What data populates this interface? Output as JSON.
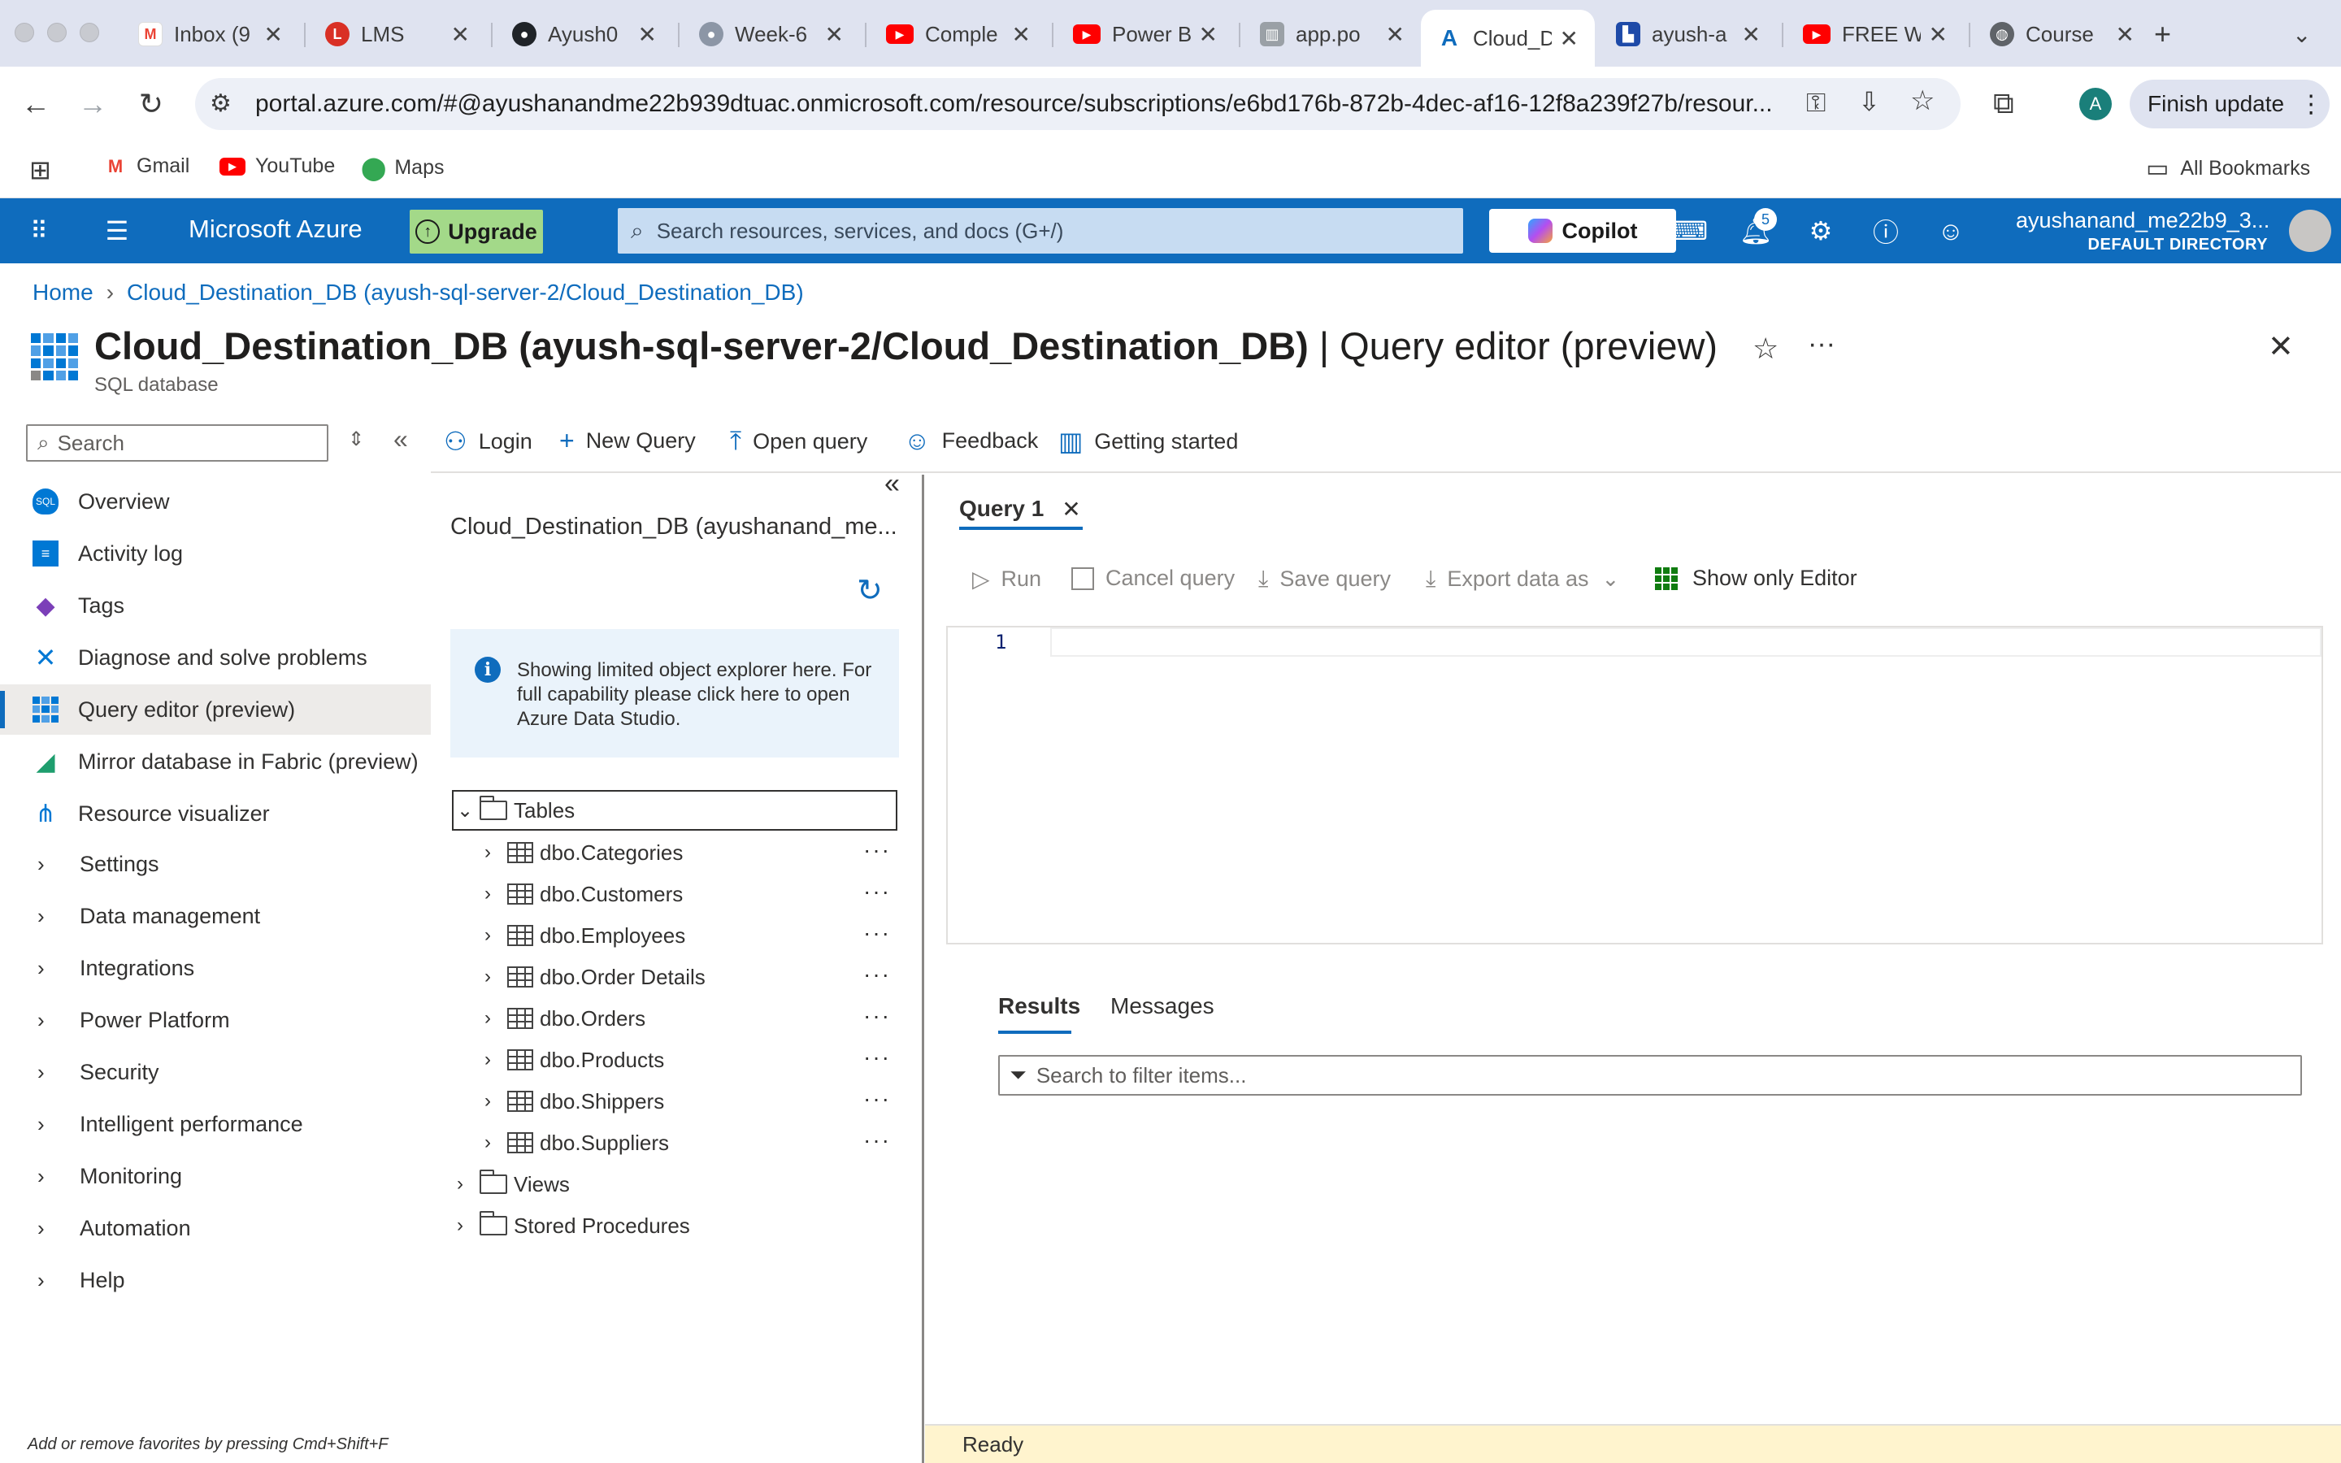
{
  "browser": {
    "tabs": [
      {
        "title": "Inbox (9",
        "icon": "gmail-icon",
        "color": "#ea4335"
      },
      {
        "title": "LMS",
        "icon": "lms-icon",
        "color": "#d93025"
      },
      {
        "title": "Ayush0",
        "icon": "github-icon",
        "color": "#1f2328"
      },
      {
        "title": "Week-6",
        "icon": "github-icon",
        "color": "#8c96a6"
      },
      {
        "title": "Comple",
        "icon": "youtube-icon",
        "color": "#ff0000"
      },
      {
        "title": "Power B",
        "icon": "youtube-icon",
        "color": "#ff0000"
      },
      {
        "title": "app.po",
        "icon": "building-icon",
        "color": "#777777"
      },
      {
        "title": "Cloud_D",
        "icon": "azure-icon",
        "color": "#0f6cbd"
      },
      {
        "title": "ayush-a",
        "icon": "factory-icon",
        "color": "#1e4aa8"
      },
      {
        "title": "FREE W",
        "icon": "youtube-icon",
        "color": "#ff0000"
      },
      {
        "title": "Course",
        "icon": "globe-icon",
        "color": "#5f6368"
      }
    ],
    "url": "portal.azure.com/#@ayushanandme22b939dtuac.onmicrosoft.com/resource/subscriptions/e6bd176b-872b-4dec-af16-12f8a239f27b/resour...",
    "finish_update": "Finish update",
    "profile_initial": "A",
    "bookmarks": [
      "Gmail",
      "YouTube",
      "Maps"
    ],
    "all_bookmarks": "All Bookmarks"
  },
  "azure": {
    "brand": "Microsoft Azure",
    "upgrade": "Upgrade",
    "search_placeholder": "Search resources, services, and docs (G+/)",
    "copilot": "Copilot",
    "notification_count": "5",
    "user_name": "ayushanand_me22b9_3...",
    "user_directory": "DEFAULT DIRECTORY"
  },
  "page": {
    "breadcrumb": [
      "Home",
      "Cloud_Destination_DB (ayush-sql-server-2/Cloud_Destination_DB)"
    ],
    "title": "Cloud_Destination_DB (ayush-sql-server-2/Cloud_Destination_DB)",
    "title_suffix": " | Query editor (preview)",
    "subtitle": "SQL database"
  },
  "menu": {
    "search_placeholder": "Search",
    "items": [
      {
        "label": "Overview",
        "icon": "sql-icon"
      },
      {
        "label": "Activity log",
        "icon": "activity-log-icon"
      },
      {
        "label": "Tags",
        "icon": "tag-icon"
      },
      {
        "label": "Diagnose and solve problems",
        "icon": "wrench-icon"
      },
      {
        "label": "Query editor (preview)",
        "icon": "query-editor-icon"
      },
      {
        "label": "Mirror database in Fabric (preview)",
        "icon": "fabric-icon"
      },
      {
        "label": "Resource visualizer",
        "icon": "visualizer-icon"
      }
    ],
    "groups": [
      "Settings",
      "Data management",
      "Integrations",
      "Power Platform",
      "Security",
      "Intelligent performance",
      "Monitoring",
      "Automation",
      "Help"
    ],
    "favorites_hint": "Add or remove favorites by pressing Cmd+Shift+F"
  },
  "commands": {
    "login": "Login",
    "new_query": "New Query",
    "open_query": "Open query",
    "feedback": "Feedback",
    "getting_started": "Getting started"
  },
  "explorer": {
    "title": "Cloud_Destination_DB (ayushanand_me...",
    "info": "Showing limited object explorer here. For full capability please click here to open Azure Data Studio.",
    "tables_label": "Tables",
    "tables": [
      "dbo.Categories",
      "dbo.Customers",
      "dbo.Employees",
      "dbo.Order Details",
      "dbo.Orders",
      "dbo.Products",
      "dbo.Shippers",
      "dbo.Suppliers"
    ],
    "views_label": "Views",
    "procs_label": "Stored Procedures"
  },
  "query": {
    "tab_label": "Query 1",
    "run": "Run",
    "cancel": "Cancel query",
    "save": "Save query",
    "export": "Export data as",
    "show_editor": "Show only Editor",
    "line_number": "1",
    "results_tab": "Results",
    "messages_tab": "Messages",
    "filter_placeholder": "Search to filter items...",
    "status": "Ready"
  }
}
